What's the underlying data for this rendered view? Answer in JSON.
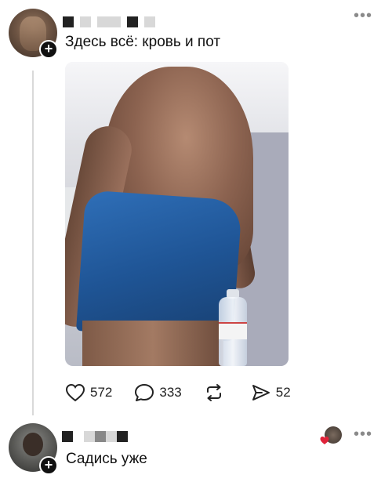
{
  "post": {
    "text": "Здесь всё: кровь и пот",
    "actions": {
      "likes": "572",
      "comments": "333",
      "shares": "52"
    }
  },
  "reply": {
    "text": "Садись уже"
  },
  "icons": {
    "follow": "+",
    "more": "•••",
    "like": "heart-icon",
    "comment": "comment-bubble-icon",
    "repost": "repost-icon",
    "share": "send-icon"
  },
  "colors": {
    "text": "#111111",
    "muted": "#8a8a8a",
    "reaction_heart": "#e0233a",
    "thread_line": "#d9d9d9"
  }
}
